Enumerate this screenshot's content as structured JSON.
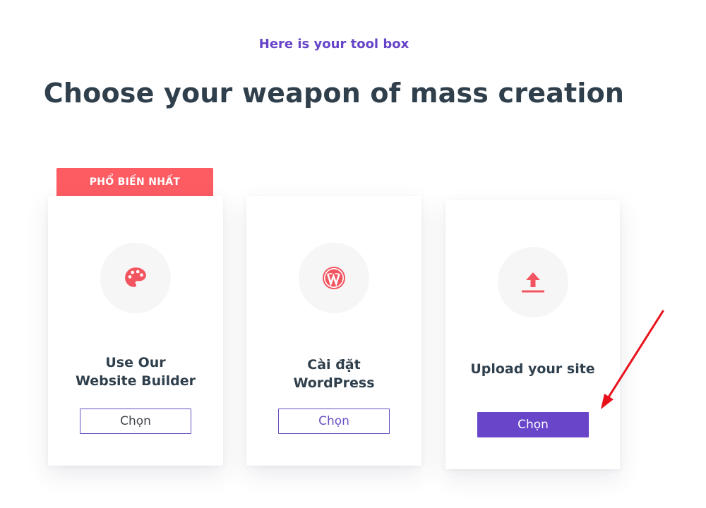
{
  "header": {
    "eyebrow": "Here is your tool box",
    "headline": "Choose your weapon of mass creation"
  },
  "badge": {
    "label": "PHỔ BIẾN NHẤT"
  },
  "cards": [
    {
      "icon": "palette-icon",
      "title_lines": [
        "Use Our",
        "Website Builder"
      ],
      "button_label": "Chọn"
    },
    {
      "icon": "wordpress-icon",
      "title_lines": [
        "Cài đặt",
        "WordPress"
      ],
      "button_label": "Chọn"
    },
    {
      "icon": "upload-icon",
      "title_lines": [
        "Upload your site"
      ],
      "button_label": "Chọn"
    }
  ],
  "colors": {
    "accent": "#6845c9",
    "badge": "#fd5c63",
    "icon": "#f25560",
    "annotation_arrow": "#e8111b"
  }
}
